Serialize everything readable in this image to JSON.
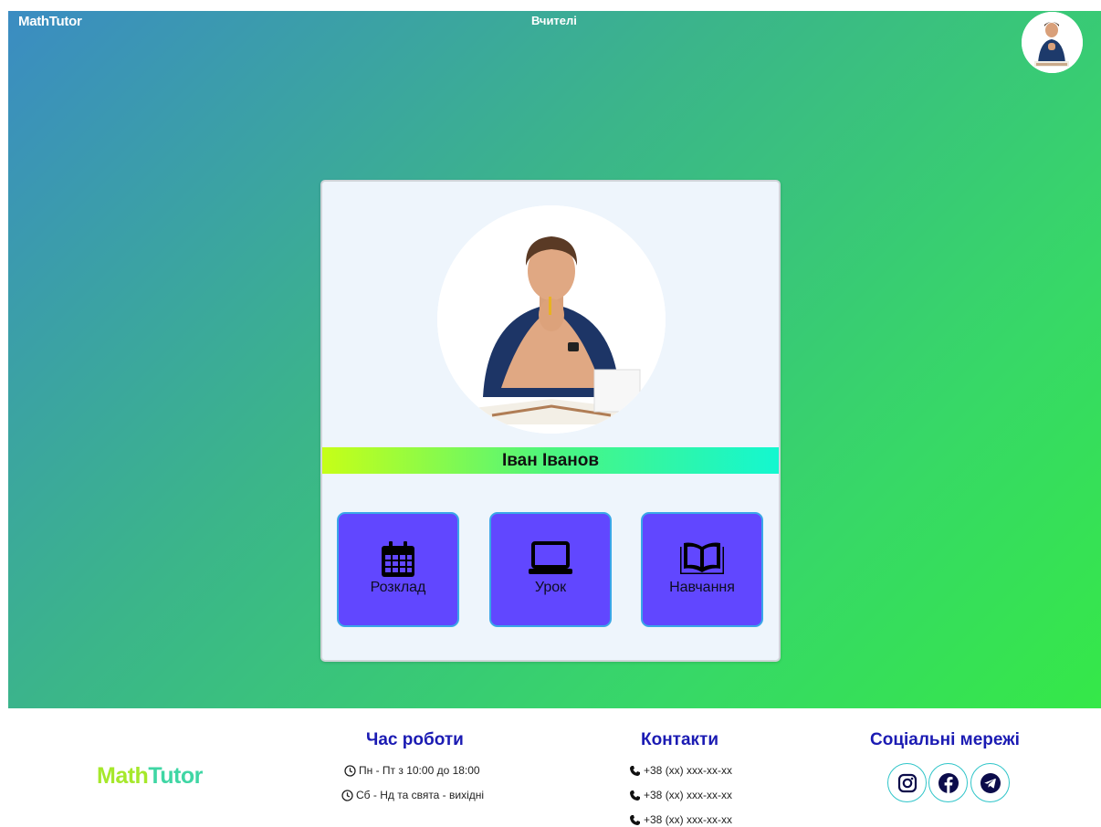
{
  "header": {
    "brand": "MathTutor",
    "nav_teachers": "Вчителі"
  },
  "teacher": {
    "name": "Іван Іванов"
  },
  "tiles": [
    {
      "label": "Розклад",
      "icon": "calendar-icon"
    },
    {
      "label": "Урок",
      "icon": "laptop-icon"
    },
    {
      "label": "Навчання",
      "icon": "book-icon"
    }
  ],
  "footer": {
    "brand_part1": "Math",
    "brand_part2": "Tutor",
    "hours": {
      "title": "Час роботи",
      "lines": [
        "Пн - Пт з 10:00 до 18:00",
        "Сб - Нд та свята - вихідні"
      ]
    },
    "contacts": {
      "title": "Контакти",
      "phones": [
        "+38 (xx) xxx-xx-xx",
        "+38 (xx) xxx-xx-xx",
        "+38 (xx) xxx-xx-xx"
      ]
    },
    "social": {
      "title": "Соціальні мережі",
      "icons": [
        "instagram-icon",
        "facebook-icon",
        "telegram-icon"
      ]
    }
  },
  "colors": {
    "tile_bg": "#6147ff",
    "footer_title": "#1b1bb3",
    "hero_start": "#3b8cc2",
    "hero_end": "#35e848"
  }
}
